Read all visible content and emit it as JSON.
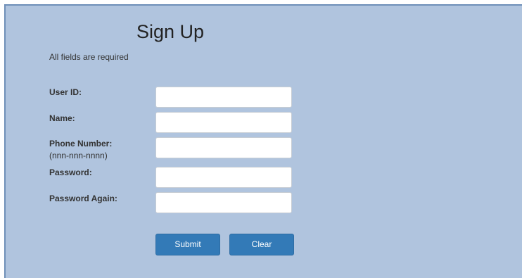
{
  "form": {
    "title": "Sign Up",
    "note": "All fields are required",
    "fields": [
      {
        "label": "User ID:",
        "value": "",
        "placeholder": ""
      },
      {
        "label": "Name:",
        "value": "",
        "placeholder": ""
      },
      {
        "label": "Phone Number:",
        "hint": "(nnn-nnn-nnnn)",
        "value": "",
        "placeholder": ""
      },
      {
        "label": "Password:",
        "value": "",
        "placeholder": ""
      },
      {
        "label": "Password Again:",
        "value": "",
        "placeholder": ""
      }
    ],
    "buttons": {
      "submit": "Submit",
      "clear": "Clear"
    }
  },
  "colors": {
    "panel_bg": "#b0c4de",
    "button_bg": "#337ab7"
  }
}
